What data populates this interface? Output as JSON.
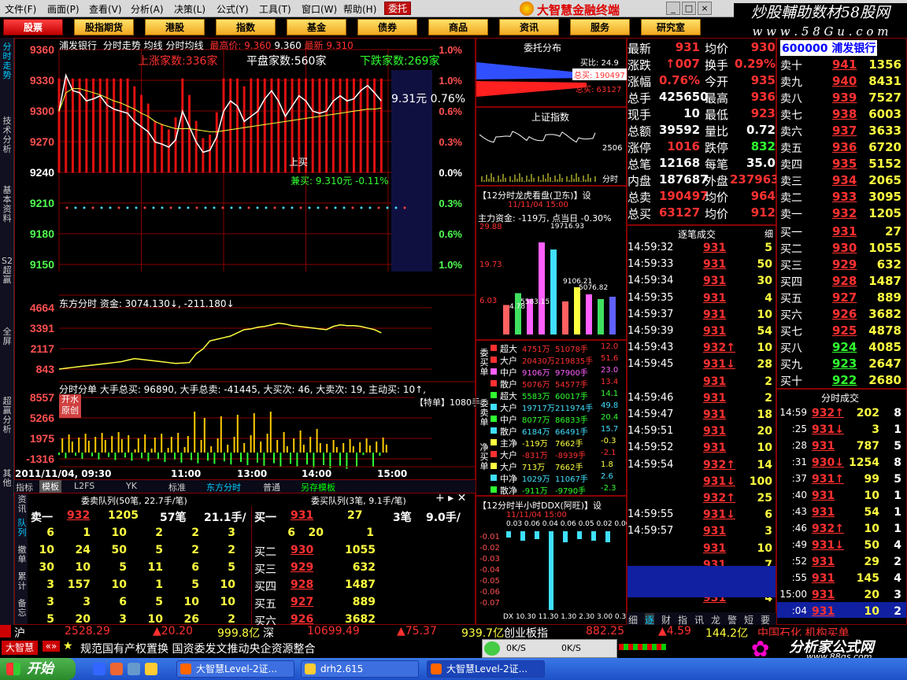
{
  "menu": [
    "文件(F)",
    "画面(P)",
    "查看(V)",
    "分析(A)",
    "决策(L)",
    "公式(Y)",
    "工具(T)",
    "窗口(W)",
    "帮助(H)"
  ],
  "weituo_label": "委托",
  "brand_title": "大智慧金融终端",
  "watermark": {
    "line1": "炒股輔助数材58股网",
    "line2": "w w w . 5 8 G u . c o m"
  },
  "toolbar": [
    "股票",
    "股指期货",
    "港股",
    "指数",
    "基金",
    "债券",
    "商品",
    "资讯",
    "服务",
    "研究室"
  ],
  "side_tabs": [
    "分时走势",
    "技术分析",
    "基本资料",
    "S2超赢",
    "全屏",
    "超赢分析",
    "其他"
  ],
  "chart_header": {
    "name": "浦发银行",
    "items": "分时走势 均线 分时均线",
    "high_label": "最高价: 9.360",
    "val1": "9.360",
    "last_label": "最新",
    "last": "9.310",
    "rise_count": "上涨家数:336家",
    "flat_count": "平盘家数:560家",
    "fall_count": "下跌家数:269家",
    "current_price": "9.31元",
    "current_pct": "0.76%",
    "label_up": "上买",
    "label_amt": "兼买: 9.310元 -0.11%"
  },
  "price_axis": [
    "9360",
    "9330",
    "9300",
    "9270",
    "9240",
    "9210",
    "9180",
    "9150"
  ],
  "pct_axis": [
    "1.0%",
    "1.0%",
    "0.6%",
    "0.3%",
    "0.0%",
    "0.3%",
    "0.6%",
    "1.0%"
  ],
  "price_line": [
    9300,
    9335,
    9320,
    9318,
    9310,
    9312,
    9315,
    9306,
    9302,
    9300,
    9298,
    9290,
    9285,
    9280,
    9270,
    9268,
    9265,
    9272,
    9300,
    9285,
    9270,
    9260,
    9262,
    9275,
    9300,
    9310,
    9305,
    9290,
    9295,
    9300,
    9312,
    9320,
    9310,
    9295,
    9305,
    9315,
    9310,
    9300,
    9298,
    9300,
    9310,
    9315,
    9310,
    9312,
    9320,
    9325,
    9318,
    9310
  ],
  "avg_line": [
    9300,
    9318,
    9322,
    9322,
    9320,
    9318,
    9316,
    9313,
    9310,
    9308,
    9305,
    9302,
    9298,
    9295,
    9290,
    9287,
    9285,
    9283,
    9283,
    9283,
    9282,
    9281,
    9280,
    9280,
    9281,
    9282,
    9283,
    9284,
    9285,
    9286,
    9287,
    9288,
    9289,
    9290,
    9291,
    9292,
    9293,
    9294,
    9295,
    9296,
    9297,
    9298,
    9299,
    9300,
    9301,
    9302,
    9302,
    9303
  ],
  "money_header": "东方分时  资金: 3074.130↓, -211.180↓",
  "money_axis": [
    "4664",
    "3391",
    "2117",
    "843"
  ],
  "money_line": [
    843,
    900,
    950,
    1000,
    1050,
    1100,
    1150,
    1200,
    1250,
    1300,
    1400,
    1500,
    1450,
    1400,
    1350,
    1300,
    1250,
    1200,
    1220,
    1250,
    1800,
    2100,
    2600,
    2700,
    2800,
    2900,
    3100,
    3300,
    3350,
    3450,
    3500,
    3600,
    3700,
    3650,
    3550,
    3500,
    3450,
    3400,
    3350,
    3300,
    3500,
    3600,
    3550,
    3550,
    3500,
    3400,
    3300,
    3100
  ],
  "bs_header": "分时分单  大手总买: 96890, 大手总卖: -41445, 大买次: 46, 大卖次: 19, 主动买: 10↑,",
  "bs_axis": [
    "8557",
    "5266",
    "1975",
    "-1316"
  ],
  "bs_badge": "开水\n原创",
  "bs_special": "【特单】1080手",
  "time_labels": {
    "start": "2011/11/04, 09:30",
    "t1": "11:00",
    "t2": "13:00",
    "t3": "14:00",
    "t4": "15:00"
  },
  "bottom_tabs": [
    "指标",
    "模板",
    "L2FS",
    "YK",
    "标准",
    "东方分时",
    "普通",
    "另存模板"
  ],
  "order_queue": {
    "sell_header": "委卖队列(50笔, 22.7手/笔)",
    "buy_header": "委买队列(3笔, 9.1手/笔)",
    "sell1_label": "卖一",
    "sell1_price": "932",
    "sell1_vol": "1205",
    "sell1_count": "57笔",
    "sell1_avg": "21.1手/",
    "buy1_label": "买一",
    "buy1_price": "931",
    "buy1_vol": "27",
    "buy1_count": "3笔",
    "buy1_avg": "9.0手/"
  },
  "sell_grid": [
    [
      "6",
      "1",
      "10",
      "2",
      "2",
      "3"
    ],
    [
      "10",
      "24",
      "50",
      "5",
      "2",
      "2"
    ],
    [
      "30",
      "10",
      "5",
      "11",
      "6",
      "5"
    ],
    [
      "3",
      "157",
      "10",
      "1",
      "5",
      "10"
    ],
    [
      "3",
      "3",
      "6",
      "5",
      "10",
      "10"
    ],
    [
      "5",
      "20",
      "3",
      "10",
      "26",
      "2"
    ]
  ],
  "buy_grid": [
    [
      "",
      "6",
      "20",
      "1"
    ],
    [
      "买二",
      "930",
      "1055"
    ],
    [
      "买三",
      "929",
      "632"
    ],
    [
      "买四",
      "928",
      "1487"
    ],
    [
      "买五",
      "927",
      "889"
    ],
    [
      "买六",
      "926",
      "3682"
    ]
  ],
  "order_tabs": [
    "资讯",
    "队列",
    "撤单",
    "累计",
    "备忘"
  ],
  "entrust": {
    "title": "委托分布",
    "buy_ratio": "买比: 24.9",
    "total_buy": "总买: 190497",
    "total_sell": "总买: 63127"
  },
  "index_panel": {
    "title": "上证指数",
    "value": "2506",
    "time": "分时"
  },
  "dragon": {
    "title": "【12分时龙虎看盘(卫东)】设",
    "time": "11/11/04 15:00",
    "main_funds": "主力资金: -119万, 点当日 -0.30%",
    "axis": [
      "29.88",
      "19.73",
      "6.03"
    ],
    "bar_labels": [
      "4.78",
      "5583.15",
      "19716.93",
      "9106.21",
      "5076.82"
    ]
  },
  "dragon_bars": [
    {
      "h": 25,
      "c": "#ff6060"
    },
    {
      "h": 35,
      "c": "#40e060"
    },
    {
      "h": 30,
      "c": "#ff60ff"
    },
    {
      "h": 78,
      "c": "#ff60ff"
    },
    {
      "h": 72,
      "c": "#40e0ff"
    },
    {
      "h": 28,
      "c": "#ff6060"
    },
    {
      "h": 40,
      "c": "#ffff40"
    },
    {
      "h": 34,
      "c": "#ff60ff"
    },
    {
      "h": 30,
      "c": "#40e060"
    },
    {
      "h": 32,
      "c": "#6060ff"
    }
  ],
  "order_class": {
    "buy_label": "委买单",
    "sell_label": "委卖单",
    "net_label": "净买单",
    "rows": [
      [
        "超大",
        "4751万",
        "51078手",
        "12.0"
      ],
      [
        "大户",
        "20430万",
        "219835手",
        "51.6"
      ],
      [
        "中户",
        "9106万",
        "97900手",
        "23.0"
      ],
      [
        "散户",
        "5076万",
        "54577手",
        "13.4"
      ],
      [
        "超大",
        "5583万",
        "60017手",
        "14.1"
      ],
      [
        "大户",
        "19717万",
        "211974手",
        "49.8"
      ],
      [
        "中户",
        "8077万",
        "86833手",
        "20.4"
      ],
      [
        "散户",
        "6184万",
        "66491手",
        "15.7"
      ],
      [
        "主净",
        "-119万",
        "7662手",
        "-0.3"
      ],
      [
        "大户",
        "-831万",
        "-8939手",
        "-2.1"
      ],
      [
        "大户",
        "713万",
        "7662手",
        "1.8"
      ],
      [
        "中净",
        "1029万",
        "11067手",
        "2.6"
      ],
      [
        "散净",
        "-911万",
        "-9790手",
        "-2.3"
      ]
    ]
  },
  "ddx": {
    "title": "【12分时半小时DDX(阿旺)】设",
    "time": "11/11/04 15:00",
    "labels": "0.03 0.06 0.04 0.06 0.05 0.02 0.06 0.04",
    "ticks": [
      "-0.01",
      "-0.02",
      "-0.03",
      "-0.04",
      "-0.05",
      "-0.06",
      "-0.07"
    ],
    "xaxis": "DX 10.30 11.30 1.30 2.30 3.00 0.3.00 0"
  },
  "quote": {
    "code": "600000",
    "name": "浦发银行",
    "rows": [
      [
        "最新",
        "931",
        "均价",
        "930"
      ],
      [
        "涨跌",
        "↑007",
        "换手",
        "0.29%"
      ],
      [
        "涨幅",
        "0.76%",
        "今开",
        "935"
      ],
      [
        "总手",
        "425650",
        "最高",
        "936"
      ],
      [
        "现手",
        "10",
        "最低",
        "923"
      ],
      [
        "总额",
        "39592",
        "量比",
        "0.72"
      ],
      [
        "涨停",
        "1016",
        "跌停",
        "832"
      ],
      [
        "总笔",
        "12168",
        "每笔",
        "35.0"
      ],
      [
        "内盘",
        "187687",
        "外盘",
        "237963"
      ],
      [
        "总卖",
        "190497",
        "均价",
        "964"
      ],
      [
        "总买",
        "63127",
        "均价",
        "912"
      ]
    ]
  },
  "book": {
    "sells": [
      [
        "卖十",
        "941",
        "1356"
      ],
      [
        "卖九",
        "940",
        "8431"
      ],
      [
        "卖八",
        "939",
        "7527"
      ],
      [
        "卖七",
        "938",
        "6003"
      ],
      [
        "卖六",
        "937",
        "3633"
      ],
      [
        "卖五",
        "936",
        "6720"
      ],
      [
        "卖四",
        "935",
        "5152"
      ],
      [
        "卖三",
        "934",
        "2065"
      ],
      [
        "卖二",
        "933",
        "3095"
      ],
      [
        "卖一",
        "932",
        "1205"
      ]
    ],
    "buys": [
      [
        "买一",
        "931",
        "27"
      ],
      [
        "买二",
        "930",
        "1055"
      ],
      [
        "买三",
        "929",
        "632"
      ],
      [
        "买四",
        "928",
        "1487"
      ],
      [
        "买五",
        "927",
        "889"
      ],
      [
        "买六",
        "926",
        "3682"
      ],
      [
        "买七",
        "925",
        "4878"
      ],
      [
        "买八",
        "924",
        "4085"
      ],
      [
        "买九",
        "923",
        "2647"
      ],
      [
        "买十",
        "922",
        "2680"
      ]
    ]
  },
  "ticks_title": "逐笔成交",
  "ticks_settle": "细",
  "ticks": [
    [
      "14:59:32",
      "931",
      "5"
    ],
    [
      "14:59:33",
      "931",
      "50"
    ],
    [
      "14:59:34",
      "931",
      "30"
    ],
    [
      "14:59:35",
      "931",
      "4"
    ],
    [
      "14:59:37",
      "931",
      "10"
    ],
    [
      "14:59:39",
      "931",
      "54"
    ],
    [
      "14:59:43",
      "932↑",
      "10"
    ],
    [
      "14:59:45",
      "931↓",
      "28"
    ],
    [
      "",
      "931",
      "2"
    ],
    [
      "14:59:46",
      "931",
      "2"
    ],
    [
      "14:59:47",
      "931",
      "18"
    ],
    [
      "14:59:51",
      "931",
      "20"
    ],
    [
      "14:59:52",
      "931",
      "10"
    ],
    [
      "14:59:54",
      "932↑",
      "14"
    ],
    [
      "",
      "931↓",
      "100"
    ],
    [
      "",
      "932↑",
      "25"
    ],
    [
      "14:59:55",
      "931↓",
      "6"
    ],
    [
      "14:59:57",
      "931",
      "3"
    ],
    [
      "",
      "931",
      "10"
    ],
    [
      "",
      "931",
      "7"
    ],
    [
      "14:59:59",
      "931",
      "6"
    ],
    [
      "",
      "931",
      "4"
    ]
  ],
  "min_trades_title": "分时成交",
  "min_trades": [
    [
      "14:59",
      "932↑",
      "202",
      "8"
    ],
    [
      ":25",
      "931↓",
      "3",
      "1"
    ],
    [
      ":28",
      "931",
      "787",
      "5"
    ],
    [
      ":31",
      "930↓",
      "1254",
      "8"
    ],
    [
      ":37",
      "931↑",
      "99",
      "5"
    ],
    [
      ":40",
      "931",
      "10",
      "1"
    ],
    [
      ":43",
      "931",
      "54",
      "1"
    ],
    [
      ":46",
      "932↑",
      "10",
      "1"
    ],
    [
      ":49",
      "931↓",
      "50",
      "4"
    ],
    [
      ":52",
      "931",
      "29",
      "2"
    ],
    [
      ":55",
      "931",
      "145",
      "4"
    ],
    [
      "15:00",
      "931",
      "20",
      "3"
    ],
    [
      ":04",
      "931",
      "10",
      "2"
    ]
  ],
  "right_tabs": [
    "细",
    "逐",
    "财",
    "指",
    "讯",
    "龙",
    "警",
    "短",
    "要"
  ],
  "status": {
    "sh_label": "沪",
    "sh_val": "2528.29",
    "sh_chg": "▲20.20",
    "sh_amt": "999.8亿",
    "sz_label": "深",
    "sz_val": "10699.49",
    "sz_chg": "▲75.37",
    "sz_amt": "939.7亿",
    "cy_label": "创业板指",
    "cy_val": "882.25",
    "cy_chg": "▲4.59",
    "cy_amt": "144.2亿",
    "news_right": "中国石化 机构买单"
  },
  "ticker": {
    "logo": "大智慧",
    "text": "规范国有产权置换 国资委发文推动央企资源整合",
    "speed1": "0K/S",
    "speed2": "0K/S"
  },
  "taskbar": {
    "start": "开始",
    "items": [
      "大智慧Level-2证...",
      "drh2.615",
      "大智慧Level-2证..."
    ]
  },
  "bottom_brand": {
    "line1": "分析家公式网",
    "line2": "www.88gs.com"
  }
}
